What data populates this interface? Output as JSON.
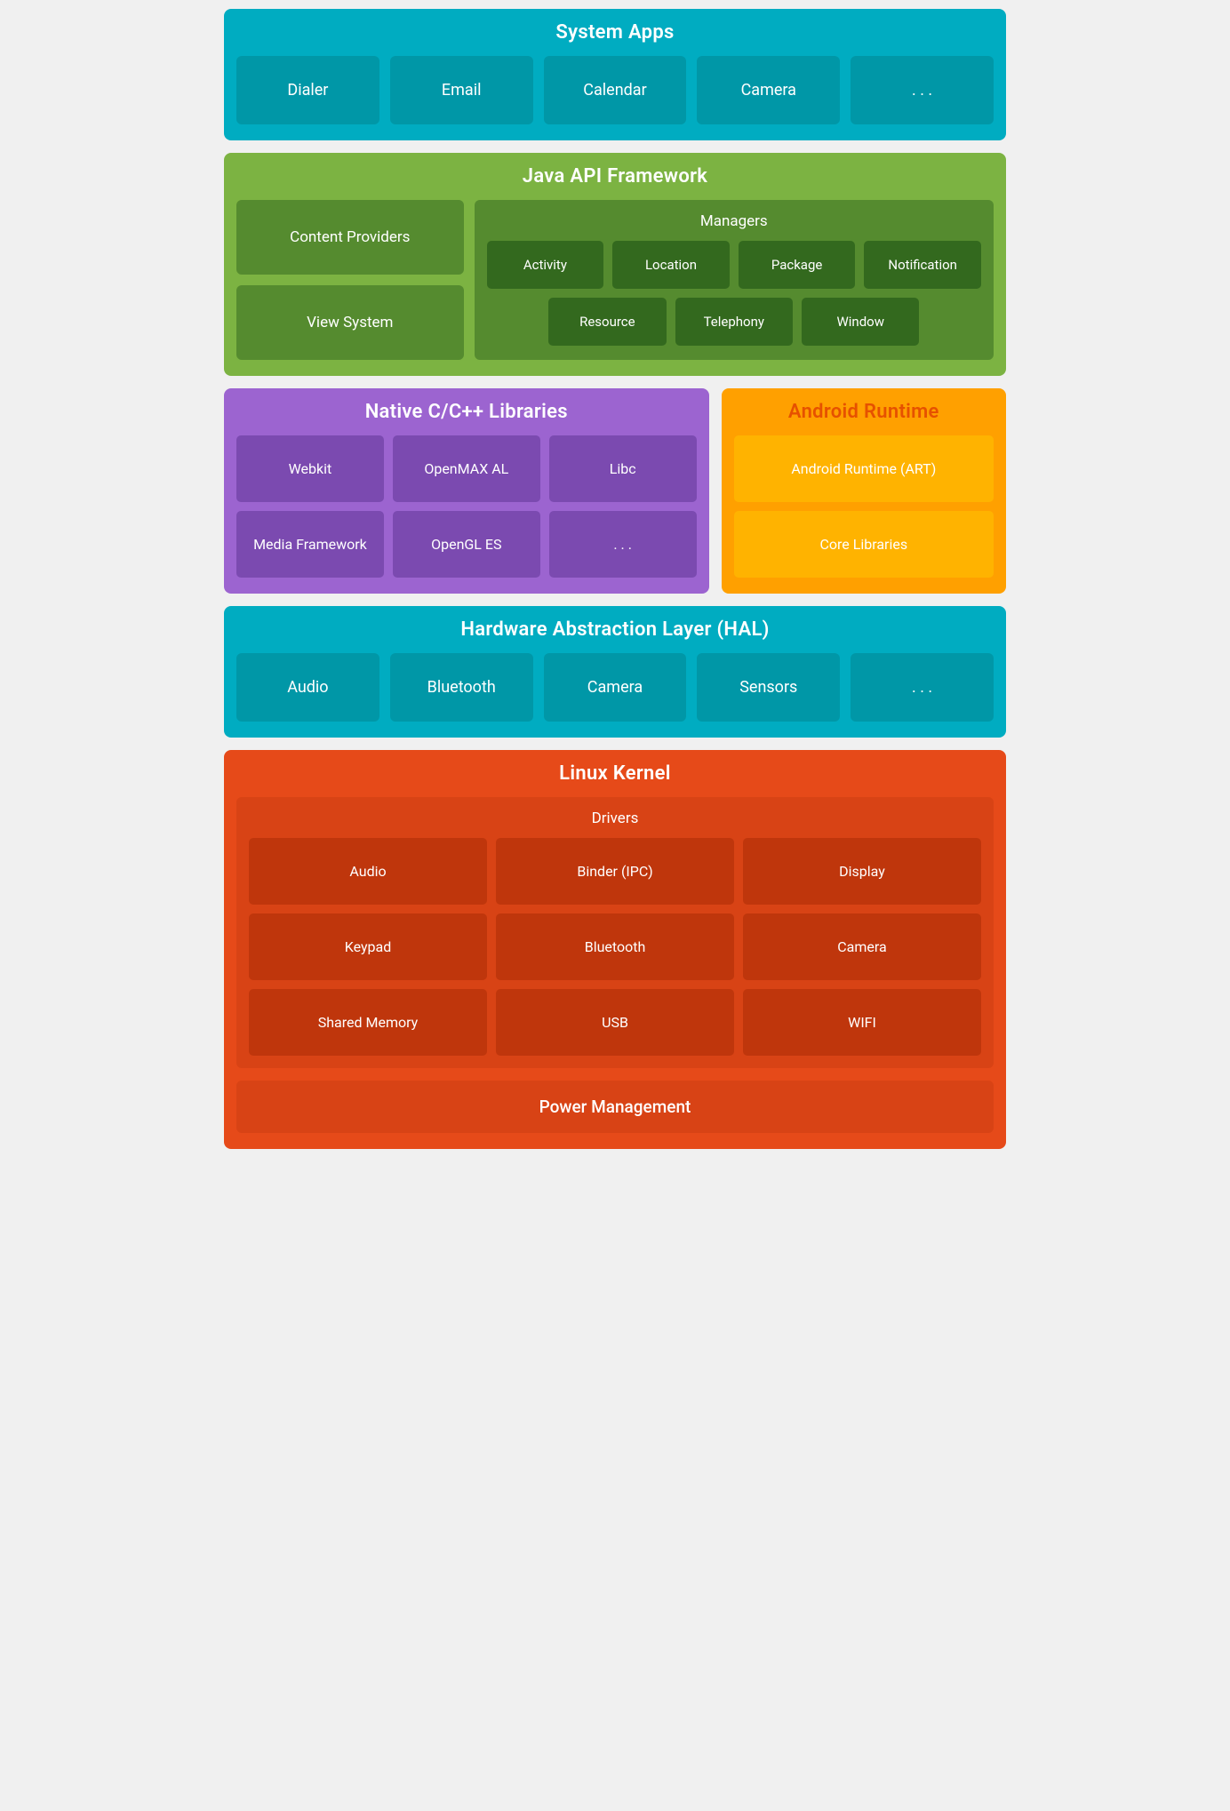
{
  "systemApps": {
    "title": "System Apps",
    "items": [
      "Dialer",
      "Email",
      "Calendar",
      "Camera",
      ". . ."
    ]
  },
  "javaAPI": {
    "title": "Java API Framework",
    "left": [
      "Content Providers",
      "View System"
    ],
    "managersTitle": "Managers",
    "managers1": [
      "Activity",
      "Location",
      "Package",
      "Notification"
    ],
    "managers2": [
      "Resource",
      "Telephony",
      "Window"
    ]
  },
  "nativeLibs": {
    "title": "Native C/C++ Libraries",
    "items": [
      "Webkit",
      "OpenMAX AL",
      "Libc",
      "Media Framework",
      "OpenGL ES",
      ". . ."
    ]
  },
  "androidRuntime": {
    "title": "Android Runtime",
    "items": [
      "Android Runtime (ART)",
      "Core Libraries"
    ]
  },
  "hal": {
    "title": "Hardware Abstraction Layer (HAL)",
    "items": [
      "Audio",
      "Bluetooth",
      "Camera",
      "Sensors",
      ". . ."
    ]
  },
  "linuxKernel": {
    "title": "Linux Kernel",
    "driversTitle": "Drivers",
    "drivers": [
      "Audio",
      "Binder (IPC)",
      "Display",
      "Keypad",
      "Bluetooth",
      "Camera",
      "Shared Memory",
      "USB",
      "WIFI"
    ],
    "powerManagement": "Power Management"
  }
}
